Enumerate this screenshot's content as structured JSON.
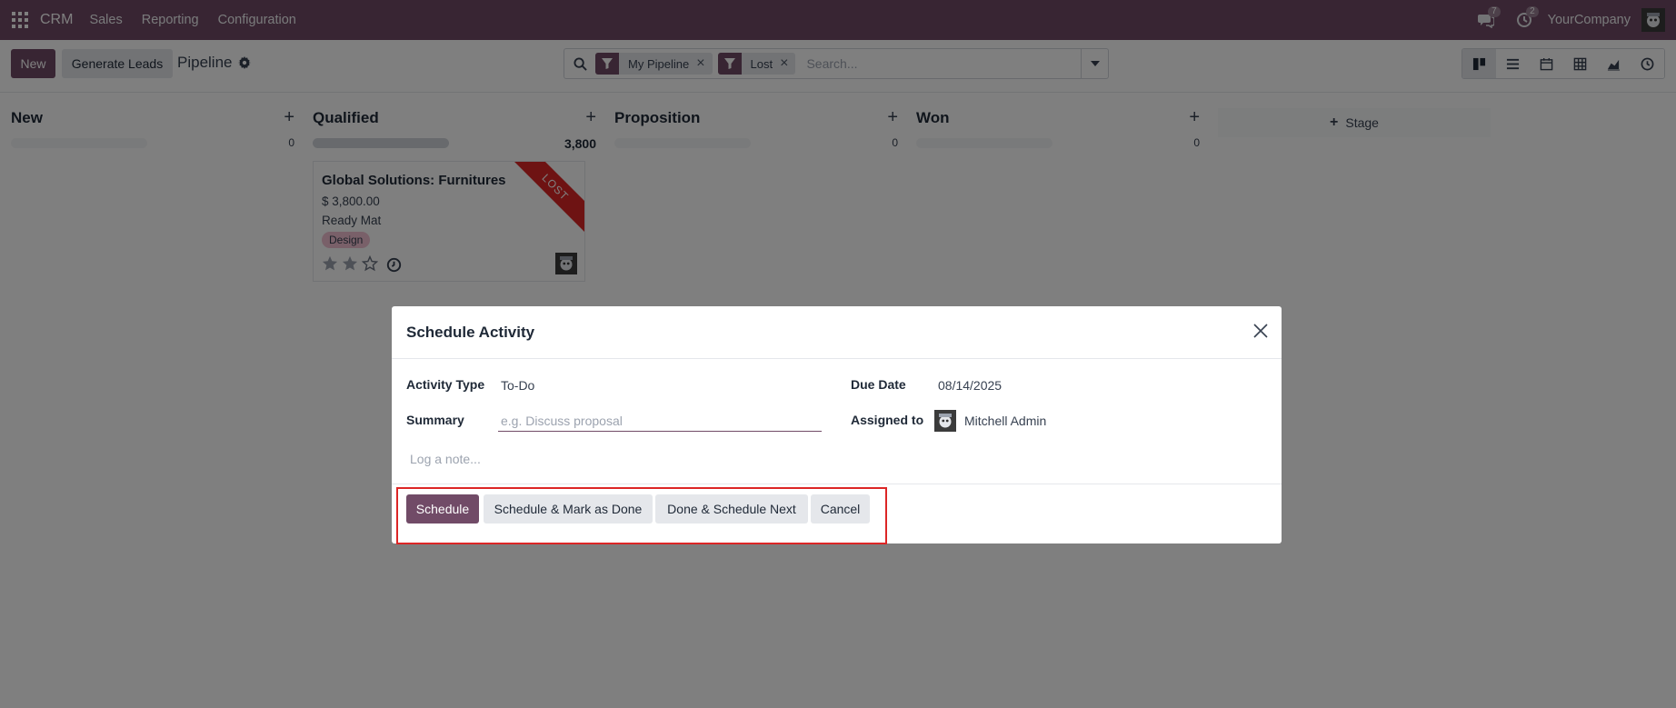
{
  "navbar": {
    "app_name": "CRM",
    "menus": [
      "Sales",
      "Reporting",
      "Configuration"
    ],
    "messages_count": "7",
    "activities_count": "2",
    "company": "YourCompany"
  },
  "control_panel": {
    "new_label": "New",
    "generate_leads_label": "Generate Leads",
    "title": "Pipeline",
    "search": {
      "facets": [
        "My Pipeline",
        "Lost"
      ],
      "placeholder": "Search..."
    },
    "views": [
      "kanban",
      "list",
      "calendar",
      "pivot",
      "graph",
      "activity"
    ],
    "active_view": "kanban"
  },
  "kanban": {
    "columns": [
      {
        "name": "New",
        "count": "0"
      },
      {
        "name": "Qualified",
        "count": "3,800"
      },
      {
        "name": "Proposition",
        "count": "0"
      },
      {
        "name": "Won",
        "count": "0"
      }
    ],
    "add_stage_label": "Stage",
    "card": {
      "title": "Global Solutions: Furnitures",
      "amount": "$ 3,800.00",
      "partner": "Ready Mat",
      "tag": "Design",
      "ribbon": "LOST",
      "stars_filled": 2,
      "stars_total": 3
    }
  },
  "modal": {
    "title": "Schedule Activity",
    "activity_type_label": "Activity Type",
    "activity_type_value": "To-Do",
    "summary_label": "Summary",
    "summary_placeholder": "e.g. Discuss proposal",
    "due_date_label": "Due Date",
    "due_date_value": "08/14/2025",
    "assigned_to_label": "Assigned to",
    "assigned_to_value": "Mitchell Admin",
    "note_placeholder": "Log a note...",
    "buttons": {
      "schedule": "Schedule",
      "schedule_done": "Schedule & Mark as Done",
      "done_next": "Done & Schedule Next",
      "cancel": "Cancel"
    }
  },
  "colors": {
    "brand": "#714b67",
    "ribbon": "#dc2626",
    "highlight": "#dc2626",
    "tag": "#f3c0d2"
  }
}
